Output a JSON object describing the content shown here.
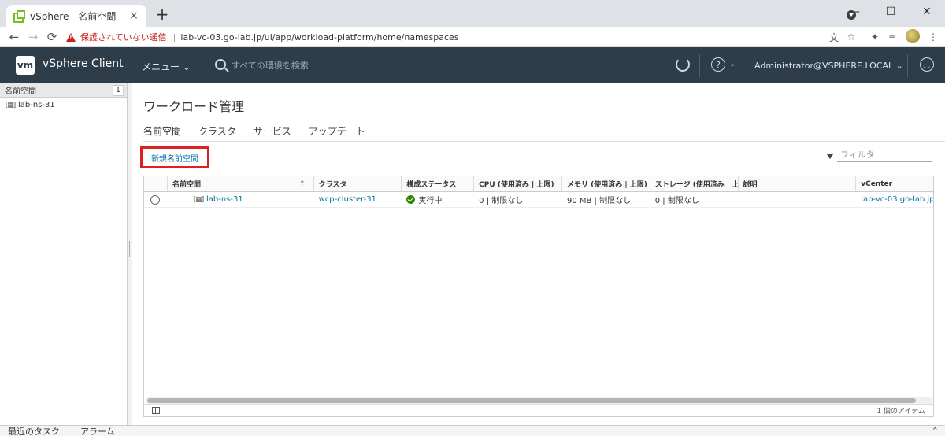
{
  "browser": {
    "tab_title": "vSphere - 名前空間",
    "tab_close": "×",
    "new_tab": "+",
    "minimize": "—",
    "maximize": "☐",
    "close": "✕",
    "back": "←",
    "forward": "→",
    "reload": "⟳",
    "insecure_label": "保護されていない通信",
    "url": "lab-vc-03.go-lab.jp/ui/app/workload-platform/home/namespaces",
    "translate_icon": "文",
    "bookmark_icon": "☆",
    "extensions_icon": "✦",
    "media_icon": "≡",
    "menu_icon": "⋮"
  },
  "header": {
    "logo": "vm",
    "app_title": "vSphere Client",
    "menu_label": "メニュー ⌄",
    "search_placeholder": "すべての環境を検索",
    "help": "?",
    "help_caret": "⌄",
    "user": "Administrator@VSPHERE.LOCAL ⌄"
  },
  "left_pane": {
    "header": "名前空間",
    "count": "1",
    "items": [
      {
        "icon": "[▦]",
        "label": "lab-ns-31"
      }
    ]
  },
  "main": {
    "title": "ワークロード管理",
    "tabs": [
      "名前空間",
      "クラスタ",
      "サービス",
      "アップデート"
    ],
    "new_namespace_button": "新規名前空間",
    "filter_placeholder": "フィルタ",
    "columns": [
      "名前空間",
      "クラスタ",
      "構成ステータス",
      "CPU (使用済み | 上限)",
      "メモリ (使用済み | 上限)",
      "ストレージ (使用済み | 上",
      "説明",
      "vCenter"
    ],
    "sort_indicator": "↑",
    "rows": [
      {
        "ns_icon": "[▦]",
        "namespace": "lab-ns-31",
        "cluster": "wcp-cluster-31",
        "status": "実行中",
        "cpu": "0 | 制限なし",
        "memory": "90 MB | 制限なし",
        "storage": "0 | 制限なし",
        "description": "",
        "vcenter": "lab-vc-03.go-lab.jp"
      }
    ],
    "item_count": "1 個のアイテム"
  },
  "bottom": {
    "recent_tasks": "最近のタスク",
    "alarms": "アラーム",
    "expand": "⌃"
  }
}
